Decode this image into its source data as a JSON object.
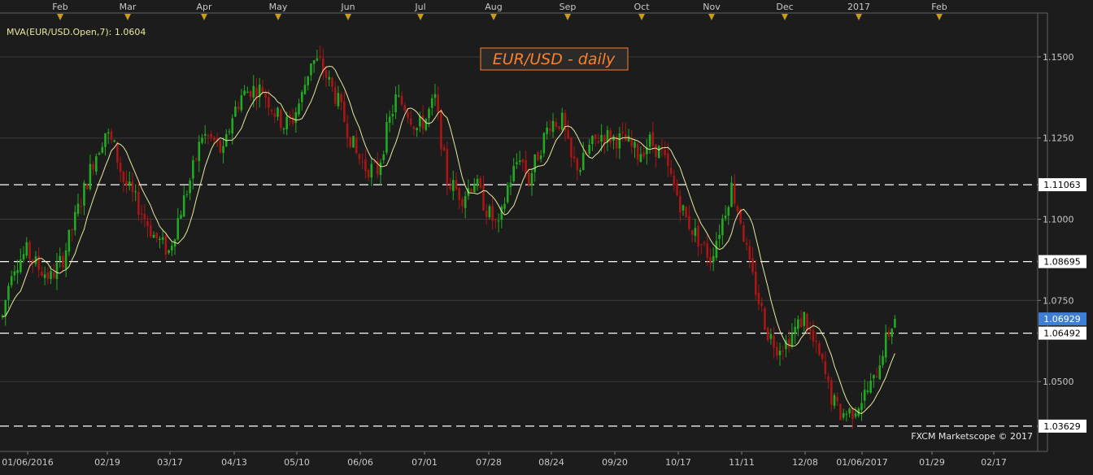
{
  "chart_data": {
    "type": "candlestick",
    "title": "EUR/USD - daily",
    "indicator_label": "MVA(EUR/USD.Open,7): 1.0604",
    "watermark": "FXCM Marketscope © 2017",
    "ylim": [
      1.0285,
      1.1635
    ],
    "y_ticks": [
      1.05,
      1.075,
      1.1,
      1.125,
      1.15
    ],
    "y_tick_labels": [
      "1.0500",
      "1.0750",
      "1.1000",
      "1.1250",
      "1.1500"
    ],
    "x_tick_labels": [
      "01/06/2016",
      "02/19",
      "03/17",
      "04/13",
      "05/10",
      "06/06",
      "07/01",
      "07/28",
      "08/24",
      "09/20",
      "10/17",
      "11/11",
      "12/08",
      "01/06/2017",
      "01/29",
      "02/17"
    ],
    "month_labels": [
      "Feb",
      "Mar",
      "Apr",
      "May",
      "Jun",
      "Jul",
      "Aug",
      "Sep",
      "Oct",
      "Nov",
      "Dec",
      "2017",
      "Feb"
    ],
    "levels": [
      {
        "value": 1.11063,
        "label": "1.11063"
      },
      {
        "value": 1.08695,
        "label": "1.08695"
      },
      {
        "value": 1.06492,
        "label": "1.06492"
      },
      {
        "value": 1.03629,
        "label": "1.03629"
      }
    ],
    "current_price": {
      "value": 1.06929,
      "label": "1.06929"
    },
    "colors": {
      "up": "#22aa22",
      "down": "#aa1515",
      "mva": "#e8e8a0",
      "current": "#3d7fd6",
      "title": "#ff7f27"
    },
    "anchors": [
      [
        0,
        1.07
      ],
      [
        3,
        1.085
      ],
      [
        8,
        1.09
      ],
      [
        12,
        1.085
      ],
      [
        16,
        1.082
      ],
      [
        20,
        1.088
      ],
      [
        24,
        1.1
      ],
      [
        30,
        1.118
      ],
      [
        34,
        1.127
      ],
      [
        37,
        1.122
      ],
      [
        40,
        1.112
      ],
      [
        45,
        1.104
      ],
      [
        50,
        1.095
      ],
      [
        55,
        1.09
      ],
      [
        58,
        1.1
      ],
      [
        62,
        1.112
      ],
      [
        66,
        1.126
      ],
      [
        70,
        1.124
      ],
      [
        73,
        1.12
      ],
      [
        76,
        1.132
      ],
      [
        79,
        1.138
      ],
      [
        82,
        1.14
      ],
      [
        86,
        1.14
      ],
      [
        90,
        1.133
      ],
      [
        93,
        1.129
      ],
      [
        96,
        1.131
      ],
      [
        99,
        1.138
      ],
      [
        102,
        1.149
      ],
      [
        105,
        1.148
      ],
      [
        108,
        1.142
      ],
      [
        111,
        1.136
      ],
      [
        114,
        1.128
      ],
      [
        117,
        1.12
      ],
      [
        120,
        1.116
      ],
      [
        124,
        1.115
      ],
      [
        127,
        1.127
      ],
      [
        130,
        1.137
      ],
      [
        133,
        1.135
      ],
      [
        137,
        1.128
      ],
      [
        140,
        1.131
      ],
      [
        143,
        1.137
      ],
      [
        147,
        1.112
      ],
      [
        152,
        1.107
      ],
      [
        156,
        1.112
      ],
      [
        160,
        1.103
      ],
      [
        164,
        1.097
      ],
      [
        167,
        1.11
      ],
      [
        171,
        1.12
      ],
      [
        174,
        1.112
      ],
      [
        177,
        1.12
      ],
      [
        181,
        1.13
      ],
      [
        185,
        1.13
      ],
      [
        188,
        1.118
      ],
      [
        191,
        1.116
      ],
      [
        194,
        1.122
      ],
      [
        198,
        1.126
      ],
      [
        202,
        1.125
      ],
      [
        206,
        1.124
      ],
      [
        210,
        1.12
      ],
      [
        214,
        1.124
      ],
      [
        218,
        1.12
      ],
      [
        222,
        1.11
      ],
      [
        226,
        1.1
      ],
      [
        230,
        1.094
      ],
      [
        234,
        1.088
      ],
      [
        238,
        1.1
      ],
      [
        241,
        1.11
      ],
      [
        244,
        1.1
      ],
      [
        247,
        1.085
      ],
      [
        250,
        1.075
      ],
      [
        253,
        1.065
      ],
      [
        256,
        1.061
      ],
      [
        259,
        1.062
      ],
      [
        262,
        1.066
      ],
      [
        265,
        1.07
      ],
      [
        268,
        1.062
      ],
      [
        271,
        1.055
      ],
      [
        274,
        1.045
      ],
      [
        277,
        1.04
      ],
      [
        281,
        1.041
      ],
      [
        285,
        1.046
      ],
      [
        288,
        1.05
      ],
      [
        291,
        1.06
      ],
      [
        293,
        1.065
      ],
      [
        295,
        1.07
      ]
    ]
  }
}
